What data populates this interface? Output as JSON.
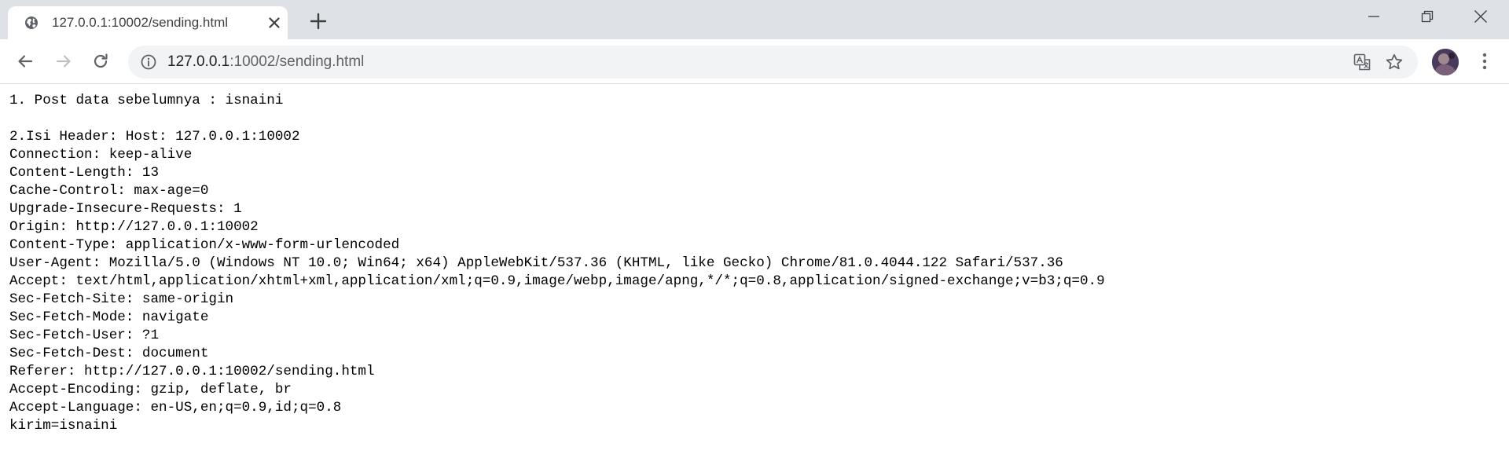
{
  "tab": {
    "title": "127.0.0.1:10002/sending.html",
    "favicon": "globe-icon"
  },
  "omnibox": {
    "host": "127.0.0.1",
    "path": ":10002/sending.html"
  },
  "page": {
    "post_data": "1. Post data sebelumnya : isnaini",
    "header_label": "2.Isi Header:",
    "headers": [
      "Host: 127.0.0.1:10002",
      "Connection: keep-alive",
      "Content-Length: 13",
      "Cache-Control: max-age=0",
      "Upgrade-Insecure-Requests: 1",
      "Origin: http://127.0.0.1:10002",
      "Content-Type: application/x-www-form-urlencoded",
      "User-Agent: Mozilla/5.0 (Windows NT 10.0; Win64; x64) AppleWebKit/537.36 (KHTML, like Gecko) Chrome/81.0.4044.122 Safari/537.36",
      "Accept: text/html,application/xhtml+xml,application/xml;q=0.9,image/webp,image/apng,*/*;q=0.8,application/signed-exchange;v=b3;q=0.9",
      "Sec-Fetch-Site: same-origin",
      "Sec-Fetch-Mode: navigate",
      "Sec-Fetch-User: ?1",
      "Sec-Fetch-Dest: document",
      "Referer: http://127.0.0.1:10002/sending.html",
      "Accept-Encoding: gzip, deflate, br",
      "Accept-Language: en-US,en;q=0.9,id;q=0.8"
    ],
    "body_line": "kirim=isnaini"
  }
}
